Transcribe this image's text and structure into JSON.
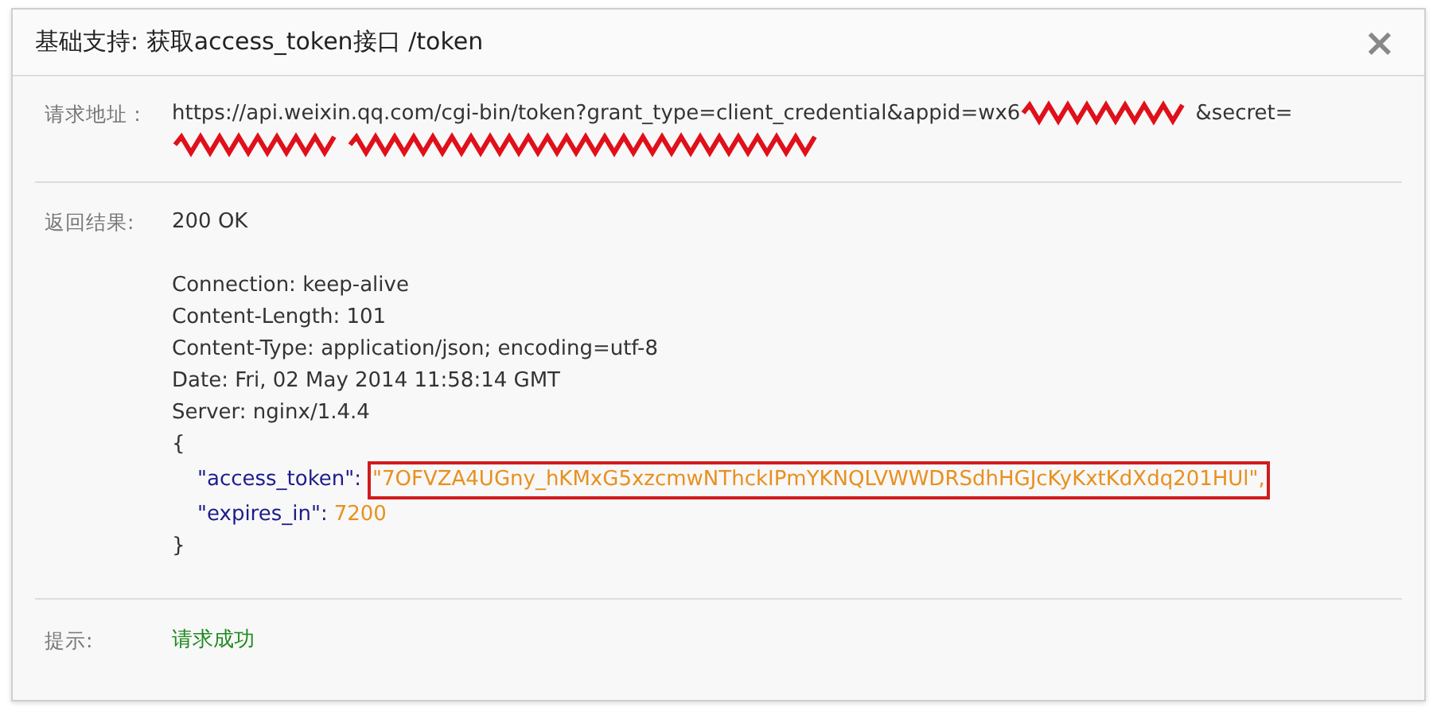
{
  "dialog": {
    "title": "基础支持: 获取access_token接口 /token",
    "close": "×"
  },
  "request": {
    "label": "请求地址：",
    "url_parts": [
      {
        "kind": "text",
        "text": "https://api.weixin.qq.com/cgi-bin/token?grant_type=client_credential&appid=wx6"
      },
      {
        "kind": "redacted"
      },
      {
        "kind": "text",
        "text": "&secret="
      },
      {
        "kind": "redacted"
      },
      {
        "kind": "redacted"
      }
    ]
  },
  "result": {
    "label": "返回结果:",
    "status": "200 OK",
    "headers": [
      "Connection: keep-alive",
      "Content-Length: 101",
      "Content-Type: application/json; encoding=utf-8",
      "Date: Fri, 02 May 2014 11:58:14 GMT",
      "Server: nginx/1.4.4"
    ],
    "body_open": "{",
    "fields": [
      {
        "key": "\"access_token\":",
        "value": "\"7OFVZA4UGny_hKMxG5xzcmwNThckIPmYKNQLVWWDRSdhHGJcKyKxtKdXdq201HUl\",",
        "highlighted": true
      },
      {
        "key": "\"expires_in\":",
        "value": "7200",
        "highlighted": false
      }
    ],
    "body_close": "}"
  },
  "tip": {
    "label": "提示:",
    "message": "请求成功"
  }
}
